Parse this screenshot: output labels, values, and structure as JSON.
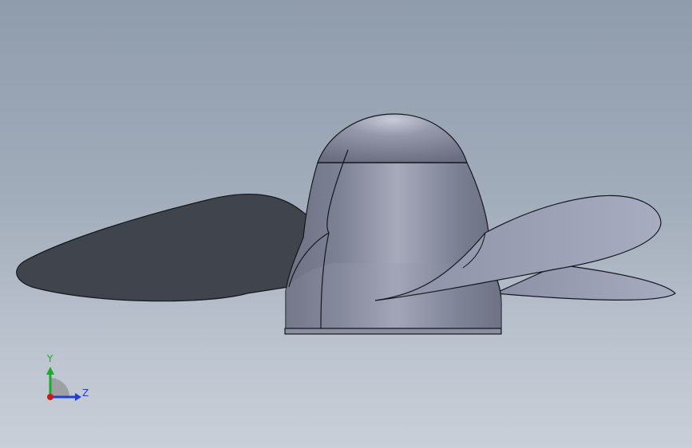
{
  "view": {
    "background_top": "#8f9cac",
    "background_bottom": "#c9cfd8"
  },
  "model": {
    "hub_color": "#8a8fa3",
    "blade_dark_color": "#40444d",
    "blade_light_color": "#9ea2b8",
    "edge_color": "#15171c"
  },
  "triad": {
    "y_label": "Y",
    "z_label": "Z",
    "y_color": "#1fa82b",
    "z_color": "#1f3fd6",
    "x_color": "#d01818"
  }
}
